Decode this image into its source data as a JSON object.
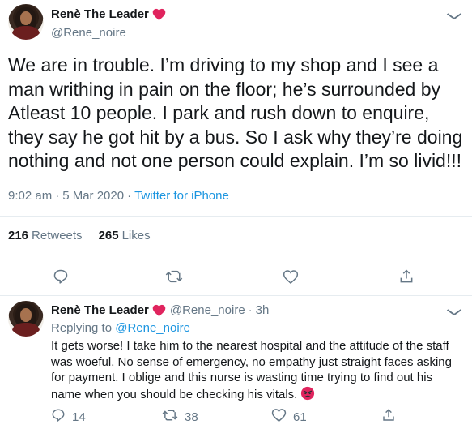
{
  "main_tweet": {
    "display_name": "Renè The Leader",
    "handle": "@Rene_noire",
    "text": "We are in trouble. I’m driving to my shop and I see a man writhing in pain on the floor; he’s surrounded by Atleast 10 people. I park and rush down to enquire, they say he got hit by a bus. So I ask why they’re doing nothing and not one person could explain. I’m so livid!!!",
    "time": "9:02 am",
    "date": "5 Mar 2020",
    "separator": "·",
    "client": "Twitter for iPhone",
    "retweets_count": "216",
    "retweets_label": "Retweets",
    "likes_count": "265",
    "likes_label": "Likes"
  },
  "reply": {
    "display_name": "Renè The Leader",
    "handle": "@Rene_noire",
    "separator": "·",
    "time_ago": "3h",
    "replying_prefix": "Replying to",
    "replying_to": "@Rene_noire",
    "text": "It gets worse! I take him to the nearest hospital and the attitude of the staff was woeful. No sense of emergency, no empathy just straight faces asking for payment. I oblige and this nurse is wasting time trying to find out his name when you should be checking his vitals.",
    "reply_count": "14",
    "retweet_count": "38",
    "like_count": "61"
  },
  "colors": {
    "accent": "#1b95e0",
    "heart": "#e0245e",
    "secondary_text": "#657786",
    "divider": "#e6ecf0"
  },
  "icons": [
    "red-heart-emoji-icon",
    "chevron-down-icon",
    "reply-icon",
    "retweet-icon",
    "like-icon",
    "share-icon",
    "angry-face-emoji-icon"
  ]
}
